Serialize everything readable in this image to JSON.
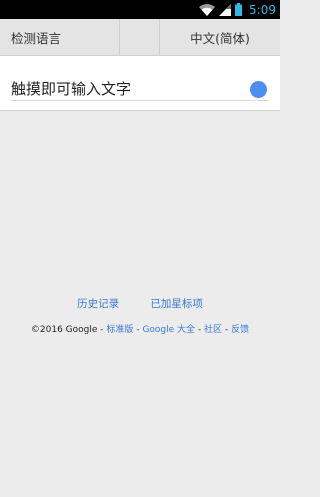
{
  "status_bar": {
    "time": "5:09",
    "icons": [
      "wifi-icon",
      "signal-icon",
      "battery-icon"
    ],
    "accent_color": "#33b5e5"
  },
  "language_bar": {
    "source_label": "检测语言",
    "target_label": "中文(简体)"
  },
  "input": {
    "placeholder": "触摸即可输入文字",
    "handwriting_color": "#4d8ff0"
  },
  "footer": {
    "links": {
      "history": "历史记录",
      "starred": "已加星标项"
    },
    "copyright": "©2016 Google",
    "sep": "-",
    "standard": "标准版",
    "google_all": "Google 大全",
    "community": "社区",
    "feedback": "反馈"
  }
}
